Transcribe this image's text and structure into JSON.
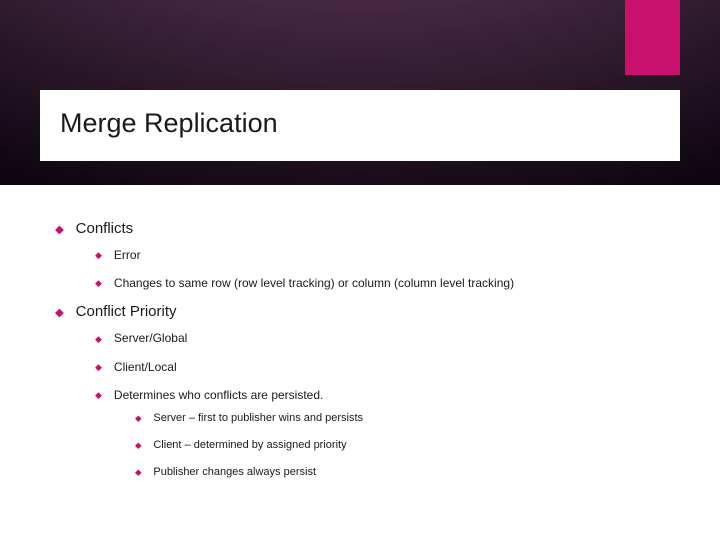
{
  "title": "Merge Replication",
  "bullets": [
    {
      "text": "Conflicts",
      "children": [
        {
          "text": "Error"
        },
        {
          "text": "Changes to same row (row level tracking) or column (column level tracking)"
        }
      ]
    },
    {
      "text": "Conflict Priority",
      "children": [
        {
          "text": "Server/Global"
        },
        {
          "text": "Client/Local"
        },
        {
          "text": "Determines who conflicts are persisted.",
          "children": [
            {
              "text": "Server – first to publisher wins and persists"
            },
            {
              "text": "Client – determined by assigned priority"
            },
            {
              "text": "Publisher changes always persist"
            }
          ]
        }
      ]
    }
  ]
}
